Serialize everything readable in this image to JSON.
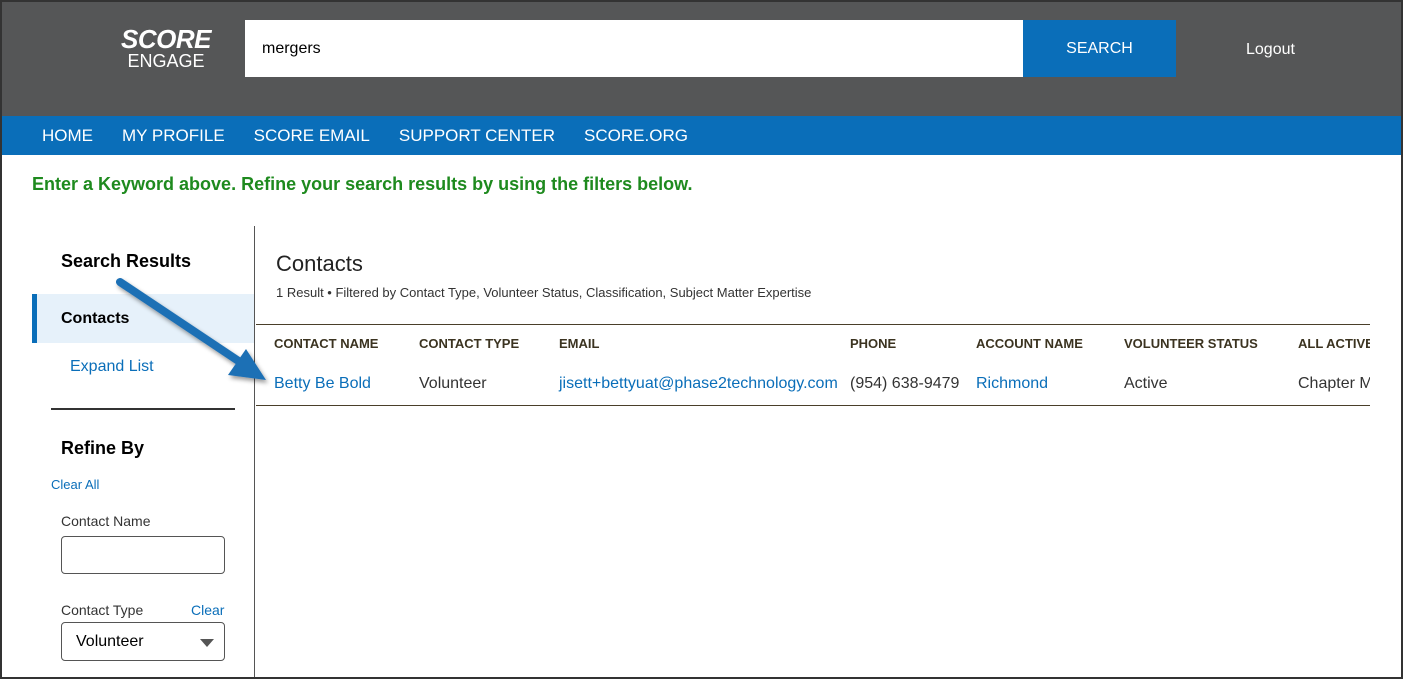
{
  "header": {
    "logo_top": "SCORE",
    "logo_bottom": "ENGAGE",
    "search_value": "mergers",
    "search_button": "SEARCH",
    "logout": "Logout"
  },
  "nav": [
    "HOME",
    "MY PROFILE",
    "SCORE EMAIL",
    "SUPPORT CENTER",
    "SCORE.ORG"
  ],
  "hint": "Enter a Keyword above. Refine your search results by using the filters below.",
  "sidebar": {
    "title": "Search Results",
    "active": "Contacts",
    "expand": "Expand List",
    "refine": "Refine By",
    "clear_all": "Clear All",
    "contact_name_label": "Contact Name",
    "contact_name_value": "",
    "contact_type_label": "Contact Type",
    "clear": "Clear",
    "contact_type_value": "Volunteer"
  },
  "main": {
    "title": "Contacts",
    "summary": "1 Result • Filtered by Contact Type, Volunteer Status, Classification, Subject Matter Expertise",
    "columns": [
      "CONTACT NAME",
      "CONTACT TYPE",
      "EMAIL",
      "PHONE",
      "ACCOUNT NAME",
      "VOLUNTEER STATUS",
      "ALL ACTIVE"
    ],
    "rows": [
      [
        "Betty Be Bold",
        "Volunteer",
        "jisett+bettyuat@phase2technology.com",
        "(954) 638-9479",
        "Richmond",
        "Active",
        "Chapter M"
      ]
    ]
  }
}
